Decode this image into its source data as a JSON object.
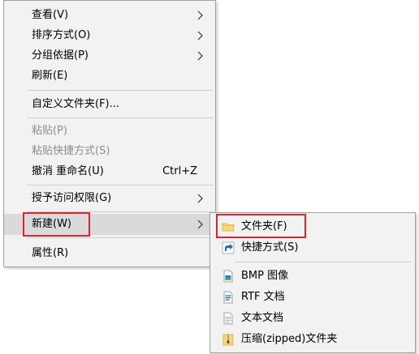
{
  "context_menu": {
    "items": [
      {
        "label": "查看(V)",
        "has_submenu": true
      },
      {
        "label": "排序方式(O)",
        "has_submenu": true
      },
      {
        "label": "分组依据(P)",
        "has_submenu": true
      },
      {
        "label": "刷新(E)"
      },
      {
        "label": "自定义文件夹(F)..."
      },
      {
        "label": "粘贴(P)",
        "disabled": true
      },
      {
        "label": "粘贴快捷方式(S)",
        "disabled": true
      },
      {
        "label": "撤消 重命名(U)",
        "shortcut": "Ctrl+Z"
      },
      {
        "label": "授予访问权限(G)",
        "has_submenu": true
      },
      {
        "label": "新建(W)",
        "has_submenu": true,
        "highlighted": true
      },
      {
        "label": "属性(R)"
      }
    ]
  },
  "new_submenu": {
    "items": [
      {
        "label": "文件夹(F)",
        "icon": "folder-icon"
      },
      {
        "label": "快捷方式(S)",
        "icon": "shortcut-icon"
      },
      {
        "label": "BMP 图像",
        "icon": "bmp-image-icon"
      },
      {
        "label": "RTF 文档",
        "icon": "rtf-document-icon"
      },
      {
        "label": "文本文档",
        "icon": "text-document-icon"
      },
      {
        "label": "压缩(zipped)文件夹",
        "icon": "zip-folder-icon"
      }
    ]
  },
  "colors": {
    "menu_bg": "#f2f2f2",
    "highlight": "#dadada",
    "disabled_text": "#8c8c8c",
    "annotation_box": "#d9272e"
  }
}
